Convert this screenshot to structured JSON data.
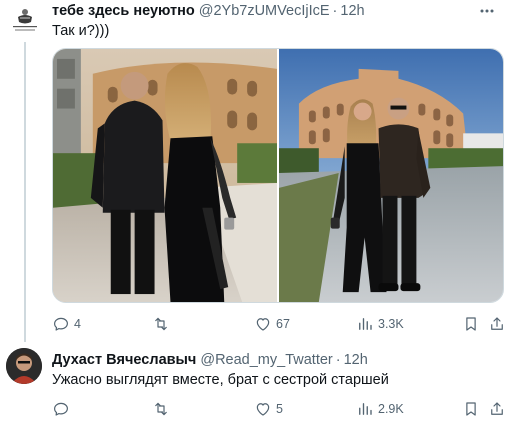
{
  "tweets": [
    {
      "display_name": "тебе здесь неуютно",
      "handle": "@2Yb7zUMVecIjIcE",
      "separator": "·",
      "time": "12h",
      "text": "Так и?)))",
      "avatar_icon": "sketch-logo-avatar",
      "media": [
        {
          "icon": "photo-couple-back-view-colosseum"
        },
        {
          "icon": "photo-couple-front-view-colosseum"
        }
      ],
      "stats": {
        "replies": "4",
        "retweets": "",
        "likes": "67",
        "views": "3.3K"
      }
    },
    {
      "display_name": "Духаст Вячеславыч",
      "handle": "@Read_my_Twatter",
      "separator": "·",
      "time": "12h",
      "text": "Ужасно выглядят вместе, брат с сестрой старшей",
      "avatar_icon": "portrait-avatar",
      "stats": {
        "replies": "",
        "retweets": "",
        "likes": "5",
        "views": "2.9K"
      }
    }
  ],
  "colors": {
    "text": "#0f1419",
    "secondary": "#536471",
    "border": "#cfd9de"
  }
}
